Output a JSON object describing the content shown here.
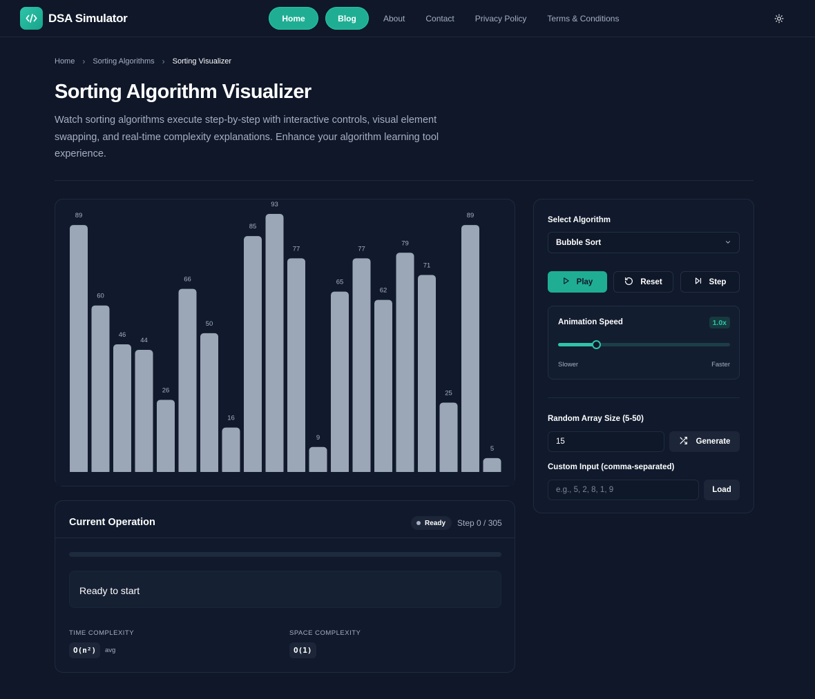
{
  "nav": {
    "brand": "DSA Simulator",
    "links": [
      {
        "label": "Home",
        "style": "pill"
      },
      {
        "label": "Blog",
        "style": "pill"
      },
      {
        "label": "About",
        "style": "link"
      },
      {
        "label": "Contact",
        "style": "link"
      },
      {
        "label": "Privacy Policy",
        "style": "link"
      },
      {
        "label": "Terms & Conditions",
        "style": "link"
      }
    ],
    "theme_icon": "sun-icon"
  },
  "breadcrumb": [
    "Home",
    "Sorting Algorithms",
    "Sorting Visualizer"
  ],
  "page": {
    "title": "Sorting Algorithm Visualizer",
    "description": "Watch sorting algorithms execute step-by-step with interactive controls, visual element swapping, and real-time complexity explanations. Enhance your algorithm learning tool experience."
  },
  "chart_data": {
    "type": "bar",
    "values": [
      89,
      60,
      46,
      44,
      26,
      66,
      50,
      16,
      85,
      93,
      77,
      9,
      65,
      77,
      62,
      79,
      71,
      25,
      89,
      5
    ],
    "bar_color": "#9ba6b6",
    "label_color": "#a6b0c3"
  },
  "operation": {
    "title": "Current Operation",
    "status": "Ready",
    "step": "Step 0 / 305",
    "progress": 0,
    "message": "Ready to start",
    "time_label": "TIME COMPLEXITY",
    "time_value": "O(n²)",
    "time_note": "avg",
    "space_label": "SPACE COMPLEXITY",
    "space_value": "O(1)"
  },
  "controls": {
    "algorithm_label": "Select Algorithm",
    "algorithm_value": "Bubble Sort",
    "play": "Play",
    "reset": "Reset",
    "step": "Step",
    "speed_label": "Animation Speed",
    "speed_value": "1.0x",
    "speed_fraction": 0.22,
    "slower": "Slower",
    "faster": "Faster",
    "size_label": "Random Array Size (5-50)",
    "size_value": "15",
    "generate": "Generate",
    "custom_label": "Custom Input (comma-separated)",
    "custom_placeholder": "e.g., 5, 2, 8, 1, 9",
    "load": "Load"
  },
  "colors": {
    "accent": "#1fae94",
    "background": "#0f1729",
    "card": "#101a2c"
  }
}
